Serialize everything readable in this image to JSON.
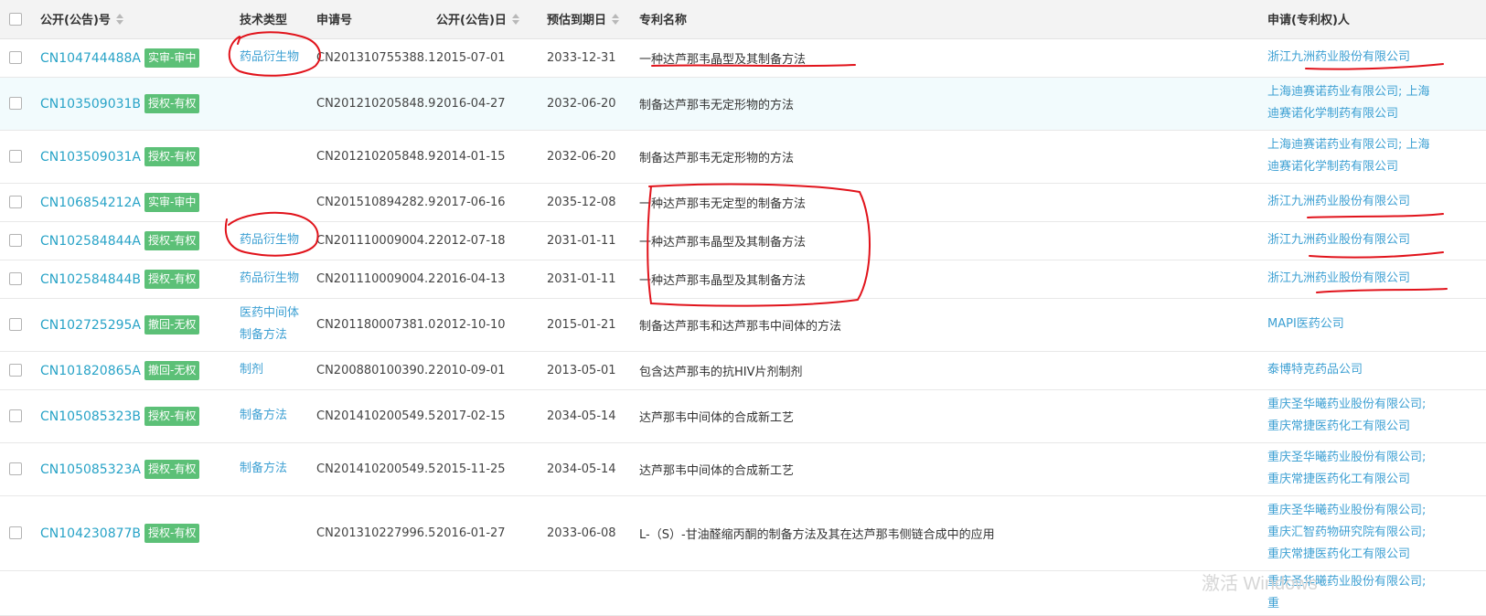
{
  "headers": {
    "pub_no": "公开(公告)号",
    "tech_type": "技术类型",
    "app_no": "申请号",
    "pub_date": "公开(公告)日",
    "expiry": "预估到期日",
    "title": "专利名称",
    "owner": "申请(专利权)人"
  },
  "colors": {
    "link": "#28a3c7",
    "badge_green": "#5cc077",
    "row_highlight": "#f2fbfd",
    "annotation_red": "#e1131b"
  },
  "rows": [
    {
      "pub_no": "CN104744488A",
      "status": "实审-审中",
      "tech": "药品衍生物",
      "app_no": "CN201310755388.1",
      "pub_date": "2015-07-01",
      "expiry": "2033-12-31",
      "title": "一种达芦那韦晶型及其制备方法",
      "owner": "浙江九洲药业股份有限公司"
    },
    {
      "pub_no": "CN103509031B",
      "status": "授权-有权",
      "tech": "",
      "app_no": "CN201210205848.9",
      "pub_date": "2016-04-27",
      "expiry": "2032-06-20",
      "title": "制备达芦那韦无定形物的方法",
      "owner": "上海迪赛诺药业有限公司; 上海迪赛诺化学制药有限公司"
    },
    {
      "pub_no": "CN103509031A",
      "status": "授权-有权",
      "tech": "",
      "app_no": "CN201210205848.9",
      "pub_date": "2014-01-15",
      "expiry": "2032-06-20",
      "title": "制备达芦那韦无定形物的方法",
      "owner": "上海迪赛诺药业有限公司; 上海迪赛诺化学制药有限公司"
    },
    {
      "pub_no": "CN106854212A",
      "status": "实审-审中",
      "tech": "",
      "app_no": "CN201510894282.9",
      "pub_date": "2017-06-16",
      "expiry": "2035-12-08",
      "title": "一种达芦那韦无定型的制备方法",
      "owner": "浙江九洲药业股份有限公司"
    },
    {
      "pub_no": "CN102584844A",
      "status": "授权-有权",
      "tech": "药品衍生物",
      "app_no": "CN201110009004.2",
      "pub_date": "2012-07-18",
      "expiry": "2031-01-11",
      "title": "一种达芦那韦晶型及其制备方法",
      "owner": "浙江九洲药业股份有限公司"
    },
    {
      "pub_no": "CN102584844B",
      "status": "授权-有权",
      "tech": "药品衍生物",
      "app_no": "CN201110009004.2",
      "pub_date": "2016-04-13",
      "expiry": "2031-01-11",
      "title": "一种达芦那韦晶型及其制备方法",
      "owner": "浙江九洲药业股份有限公司"
    },
    {
      "pub_no": "CN102725295A",
      "status": "撤回-无权",
      "tech": "医药中间体制备方法",
      "app_no": "CN201180007381.0",
      "pub_date": "2012-10-10",
      "expiry": "2015-01-21",
      "title": "制备达芦那韦和达芦那韦中间体的方法",
      "owner": "MAPI医药公司"
    },
    {
      "pub_no": "CN101820865A",
      "status": "撤回-无权",
      "tech": "制剂",
      "app_no": "CN200880100390.2",
      "pub_date": "2010-09-01",
      "expiry": "2013-05-01",
      "title": "包含达芦那韦的抗HIV片剂制剂",
      "owner": "泰博特克药品公司"
    },
    {
      "pub_no": "CN105085323B",
      "status": "授权-有权",
      "tech": "制备方法",
      "app_no": "CN201410200549.5",
      "pub_date": "2017-02-15",
      "expiry": "2034-05-14",
      "title": "达芦那韦中间体的合成新工艺",
      "owner": "重庆圣华曦药业股份有限公司; 重庆常捷医药化工有限公司"
    },
    {
      "pub_no": "CN105085323A",
      "status": "授权-有权",
      "tech": "制备方法",
      "app_no": "CN201410200549.5",
      "pub_date": "2015-11-25",
      "expiry": "2034-05-14",
      "title": "达芦那韦中间体的合成新工艺",
      "owner": "重庆圣华曦药业股份有限公司; 重庆常捷医药化工有限公司"
    },
    {
      "pub_no": "CN104230877B",
      "status": "授权-有权",
      "tech": "",
      "app_no": "CN201310227996.5",
      "pub_date": "2016-01-27",
      "expiry": "2033-06-08",
      "title": "L-（S）-甘油醛缩丙酮的制备方法及其在达芦那韦侧链合成中的应用",
      "owner": "重庆圣华曦药业股份有限公司; 重庆汇智药物研究院有限公司; 重庆常捷医药化工有限公司"
    },
    {
      "pub_no": "",
      "status": "",
      "tech": "",
      "app_no": "",
      "pub_date": "",
      "expiry": "",
      "title": "",
      "owner": "重庆圣华曦药业股份有限公司; 重"
    }
  ],
  "watermark": "激活 Windows"
}
